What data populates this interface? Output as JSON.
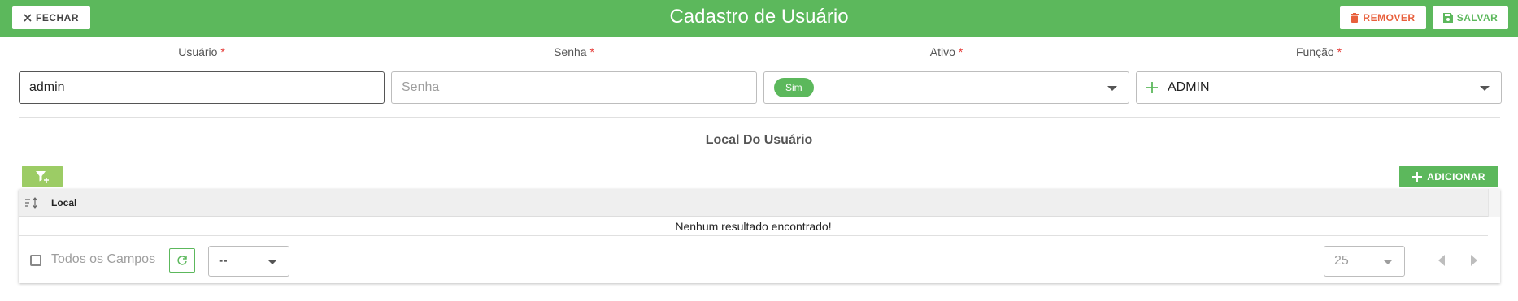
{
  "header": {
    "title": "Cadastro de Usuário",
    "close_label": "FECHAR",
    "remove_label": "REMOVER",
    "save_label": "SALVAR",
    "bar_color": "#5cb85c",
    "remove_color": "#e8603c"
  },
  "form": {
    "usuario": {
      "label": "Usuário",
      "required_mark": "*",
      "value": "admin"
    },
    "senha": {
      "label": "Senha",
      "required_mark": "*",
      "placeholder": "Senha"
    },
    "ativo": {
      "label": "Ativo",
      "required_mark": "*",
      "chip": "Sim"
    },
    "funcao": {
      "label": "Função",
      "required_mark": "*",
      "value": "ADMIN"
    }
  },
  "section": {
    "title": "Local Do Usuário",
    "add_label": "ADICIONAR"
  },
  "grid": {
    "columns": [
      "Local"
    ],
    "empty_message": "Nenhum resultado encontrado!",
    "footer": {
      "all_fields_label": "Todos os Campos",
      "field_select_value": "--",
      "page_size": "25"
    }
  },
  "icons": [
    "close-icon",
    "trash-icon",
    "floppy-disk-icon",
    "filter-plus-icon",
    "plus-icon",
    "sort-icon",
    "refresh-icon",
    "chevron-down-icon",
    "chevron-left-icon",
    "chevron-right-icon"
  ]
}
